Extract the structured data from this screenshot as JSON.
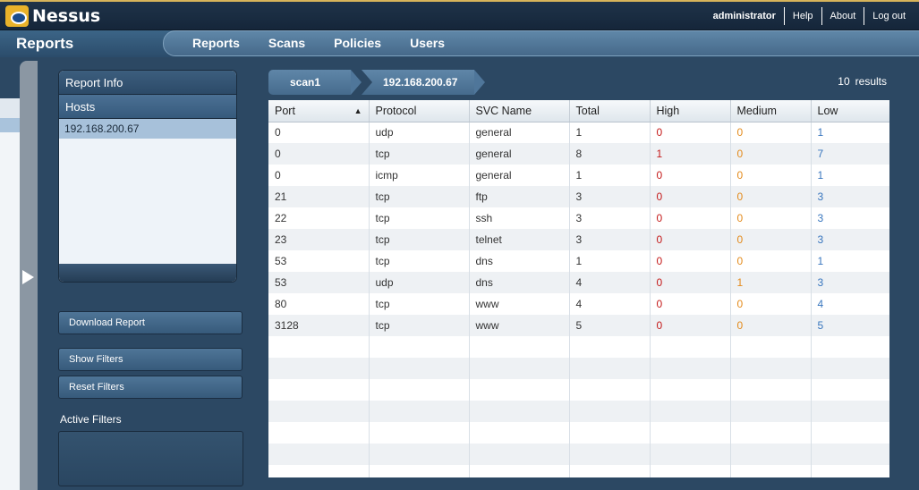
{
  "app": {
    "name": "Nessus"
  },
  "user_links": {
    "user": "administrator",
    "help": "Help",
    "about": "About",
    "logout": "Log out"
  },
  "nav": {
    "section": "Reports",
    "tabs": [
      "Reports",
      "Scans",
      "Policies",
      "Users"
    ]
  },
  "left_panel": {
    "report_info": "Report Info",
    "hosts": "Hosts",
    "host_items": [
      "192.168.200.67"
    ],
    "download_report": "Download Report",
    "show_filters": "Show Filters",
    "reset_filters": "Reset Filters",
    "active_filters": "Active Filters"
  },
  "breadcrumb": {
    "scan": "scan1",
    "host": "192.168.200.67"
  },
  "results": {
    "count": "10",
    "label": "results"
  },
  "table": {
    "columns": [
      "Port",
      "Protocol",
      "SVC Name",
      "Total",
      "High",
      "Medium",
      "Low"
    ],
    "sort_indicator": "▲",
    "rows": [
      [
        "0",
        "udp",
        "general",
        "1",
        "0",
        "0",
        "1"
      ],
      [
        "0",
        "tcp",
        "general",
        "8",
        "1",
        "0",
        "7"
      ],
      [
        "0",
        "icmp",
        "general",
        "1",
        "0",
        "0",
        "1"
      ],
      [
        "21",
        "tcp",
        "ftp",
        "3",
        "0",
        "0",
        "3"
      ],
      [
        "22",
        "tcp",
        "ssh",
        "3",
        "0",
        "0",
        "3"
      ],
      [
        "23",
        "tcp",
        "telnet",
        "3",
        "0",
        "0",
        "3"
      ],
      [
        "53",
        "tcp",
        "dns",
        "1",
        "0",
        "0",
        "1"
      ],
      [
        "53",
        "udp",
        "dns",
        "4",
        "0",
        "1",
        "3"
      ],
      [
        "80",
        "tcp",
        "www",
        "4",
        "0",
        "0",
        "4"
      ],
      [
        "3128",
        "tcp",
        "www",
        "5",
        "0",
        "0",
        "5"
      ]
    ],
    "empty_rows": 7
  },
  "colors": {
    "high": "#c41a1a",
    "medium": "#e38a1a",
    "low": "#3876be",
    "accent": "#d7b45a"
  }
}
